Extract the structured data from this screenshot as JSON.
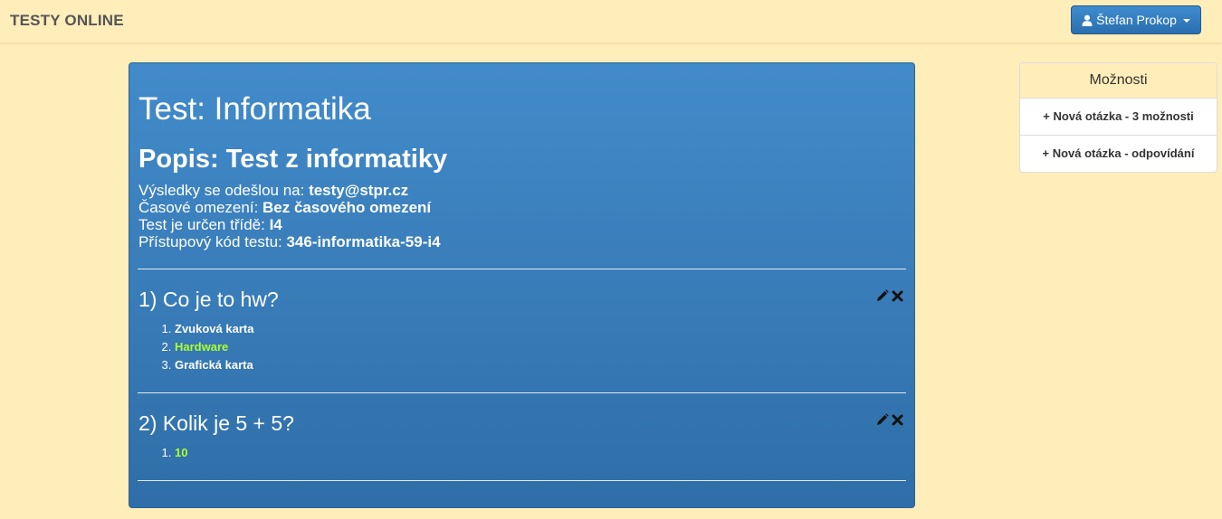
{
  "navbar": {
    "brand": "TESTY ONLINE",
    "user_name": "Štefan Prokop"
  },
  "test": {
    "title": "Test: Informatika",
    "description": "Popis: Test z informatiky",
    "meta": [
      {
        "label": "Výsledky se odešlou na: ",
        "value": "testy@stpr.cz"
      },
      {
        "label": "Časové omezení: ",
        "value": "Bez časového omezení"
      },
      {
        "label": "Test je určen třídě: ",
        "value": "I4"
      },
      {
        "label": "Přístupový kód testu: ",
        "value": "346-informatika-59-i4"
      }
    ],
    "questions": [
      {
        "title": "1) Co je to hw?",
        "answers": [
          {
            "text": "Zvuková karta",
            "correct": false
          },
          {
            "text": "Hardware",
            "correct": true
          },
          {
            "text": "Grafická karta",
            "correct": false
          }
        ]
      },
      {
        "title": "2) Kolik je 5 + 5?",
        "answers": [
          {
            "text": "10",
            "correct": true
          }
        ]
      }
    ]
  },
  "sidebar": {
    "title": "Možnosti",
    "items": [
      {
        "label": "+ Nová otázka - 3 možnosti"
      },
      {
        "label": "+ Nová otázka - odpovídání"
      }
    ]
  },
  "colors": {
    "background": "#FFEDBA",
    "panel": "#428bca",
    "correct_answer": "#adff2f"
  },
  "icons": {
    "user": "user-icon",
    "edit": "pencil-icon",
    "delete": "close-icon"
  }
}
